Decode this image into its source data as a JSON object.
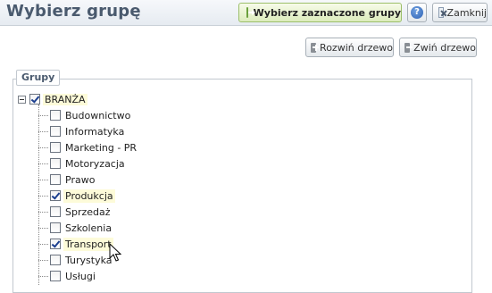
{
  "header": {
    "title": "Wybierz grupę",
    "select_button": "Wybierz zaznaczone grupy",
    "help_button": "?",
    "close_button": "Zamknij"
  },
  "toolbar": {
    "expand_tree": "Rozwiń drzewo",
    "collapse_tree": "Zwiń drzewo"
  },
  "fieldset": {
    "legend": "Grupy"
  },
  "tree": {
    "root": {
      "label": "BRANŻA",
      "checked": true,
      "expanded": true
    },
    "items": [
      {
        "label": "Budownictwo",
        "checked": false
      },
      {
        "label": "Informatyka",
        "checked": false
      },
      {
        "label": "Marketing - PR",
        "checked": false
      },
      {
        "label": "Motoryzacja",
        "checked": false
      },
      {
        "label": "Prawo",
        "checked": false
      },
      {
        "label": "Produkcja",
        "checked": true
      },
      {
        "label": "Sprzedaż",
        "checked": false
      },
      {
        "label": "Szkolenia",
        "checked": false
      },
      {
        "label": "Transport",
        "checked": true
      },
      {
        "label": "Turystyka",
        "checked": false
      },
      {
        "label": "Usługi",
        "checked": false
      }
    ]
  },
  "colors": {
    "header_bg": "#e6ebf1",
    "title_color": "#4a5a6e",
    "selected_bg": "#fcfad6",
    "primary_button_bg": "#dcecbc"
  }
}
